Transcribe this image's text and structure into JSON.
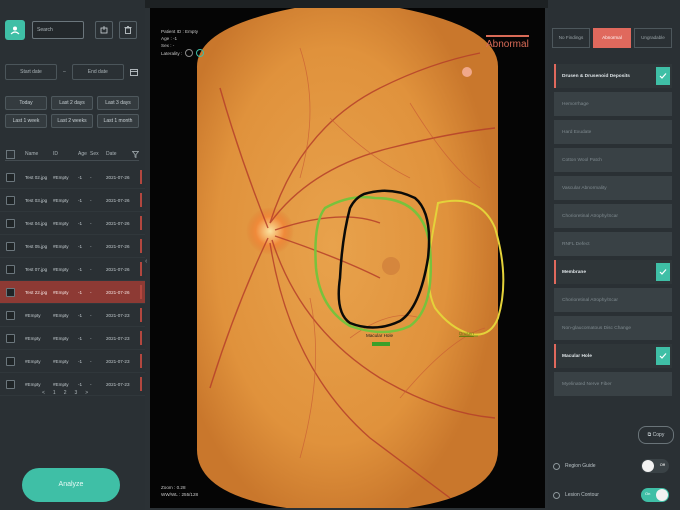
{
  "left": {
    "search_placeholder": "Search",
    "start_date": "Start date",
    "end_date": "End date",
    "ranges": [
      "Today",
      "Last 2 days",
      "Last 3 days",
      "Last 1 week",
      "Last 2 weeks",
      "Last 1 month"
    ],
    "columns": [
      "Name",
      "ID",
      "Age",
      "Sex",
      "Date"
    ],
    "rows": [
      {
        "name": "Test 02.jpg",
        "id": "#Empty",
        "age": "-1",
        "sex": "-",
        "date": "2021-07-26",
        "selected": false
      },
      {
        "name": "Test 03.jpg",
        "id": "#Empty",
        "age": "-1",
        "sex": "-",
        "date": "2021-07-26",
        "selected": false
      },
      {
        "name": "Test 04.jpg",
        "id": "#Empty",
        "age": "-1",
        "sex": "-",
        "date": "2021-07-26",
        "selected": false
      },
      {
        "name": "Test 05.jpg",
        "id": "#Empty",
        "age": "-1",
        "sex": "-",
        "date": "2021-07-26",
        "selected": false
      },
      {
        "name": "Test 07.jpg",
        "id": "#Empty",
        "age": "-1",
        "sex": "-",
        "date": "2021-07-26",
        "selected": false
      },
      {
        "name": "Test 22.jpg",
        "id": "#Empty",
        "age": "-1",
        "sex": "-",
        "date": "2021-07-26",
        "selected": true
      },
      {
        "name": "#Empty",
        "id": "#Empty",
        "age": "-1",
        "sex": "-",
        "date": "2021-07-23",
        "selected": false
      },
      {
        "name": "#Empty",
        "id": "#Empty",
        "age": "-1",
        "sex": "-",
        "date": "2021-07-23",
        "selected": false
      },
      {
        "name": "#Empty",
        "id": "#Empty",
        "age": "-1",
        "sex": "-",
        "date": "2021-07-23",
        "selected": false
      },
      {
        "name": "#Empty",
        "id": "#Empty",
        "age": "-1",
        "sex": "-",
        "date": "2021-07-23",
        "selected": false
      }
    ],
    "pager": [
      "<",
      "1",
      "2",
      "3",
      ">"
    ],
    "analyze_label": "Analyze"
  },
  "center": {
    "patient_id": "Patient ID : Empty",
    "age": "Age : -1",
    "sex": "Sex : -",
    "laterality": "Laterality :",
    "status": "Abnormal",
    "zoom": "Zoom : 0.28",
    "wwwl": "WW/WL : 255/128",
    "label_macular_hole": "Macular Hole",
    "label_drusen": "Drusen"
  },
  "right": {
    "tabs": [
      "No Findings",
      "Abnormal",
      "Ungradable"
    ],
    "active_tab": 1,
    "findings": [
      {
        "label": "Drusen & Drusenoid Deposits",
        "head": true
      },
      {
        "label": "Hemorrhage",
        "head": false
      },
      {
        "label": "Hard Exudate",
        "head": false
      },
      {
        "label": "Cotton Wool Patch",
        "head": false
      },
      {
        "label": "Vascular Abnormality",
        "head": false
      },
      {
        "label": "Chorioretinal Atrophy/Scar",
        "head": false
      },
      {
        "label": "RNFL Defect",
        "head": false
      },
      {
        "label": "Membrane",
        "head": true
      },
      {
        "label": "Chorioretinal Atrophy/Scar",
        "head": false
      },
      {
        "label": "Non-glaucomatous Disc Change",
        "head": false
      },
      {
        "label": "Macular Hole",
        "head": true
      },
      {
        "label": "Myelinated Nerve Fiber",
        "head": false
      }
    ],
    "copy_label": "Copy",
    "region_guide": "Region Guide",
    "region_guide_state": "Off",
    "lesion_contour": "Lesion Contour",
    "lesion_contour_state": "On"
  },
  "colors": {
    "accent": "#3fbfa6",
    "alert": "#e0695d",
    "fundus": "#e09a45"
  }
}
